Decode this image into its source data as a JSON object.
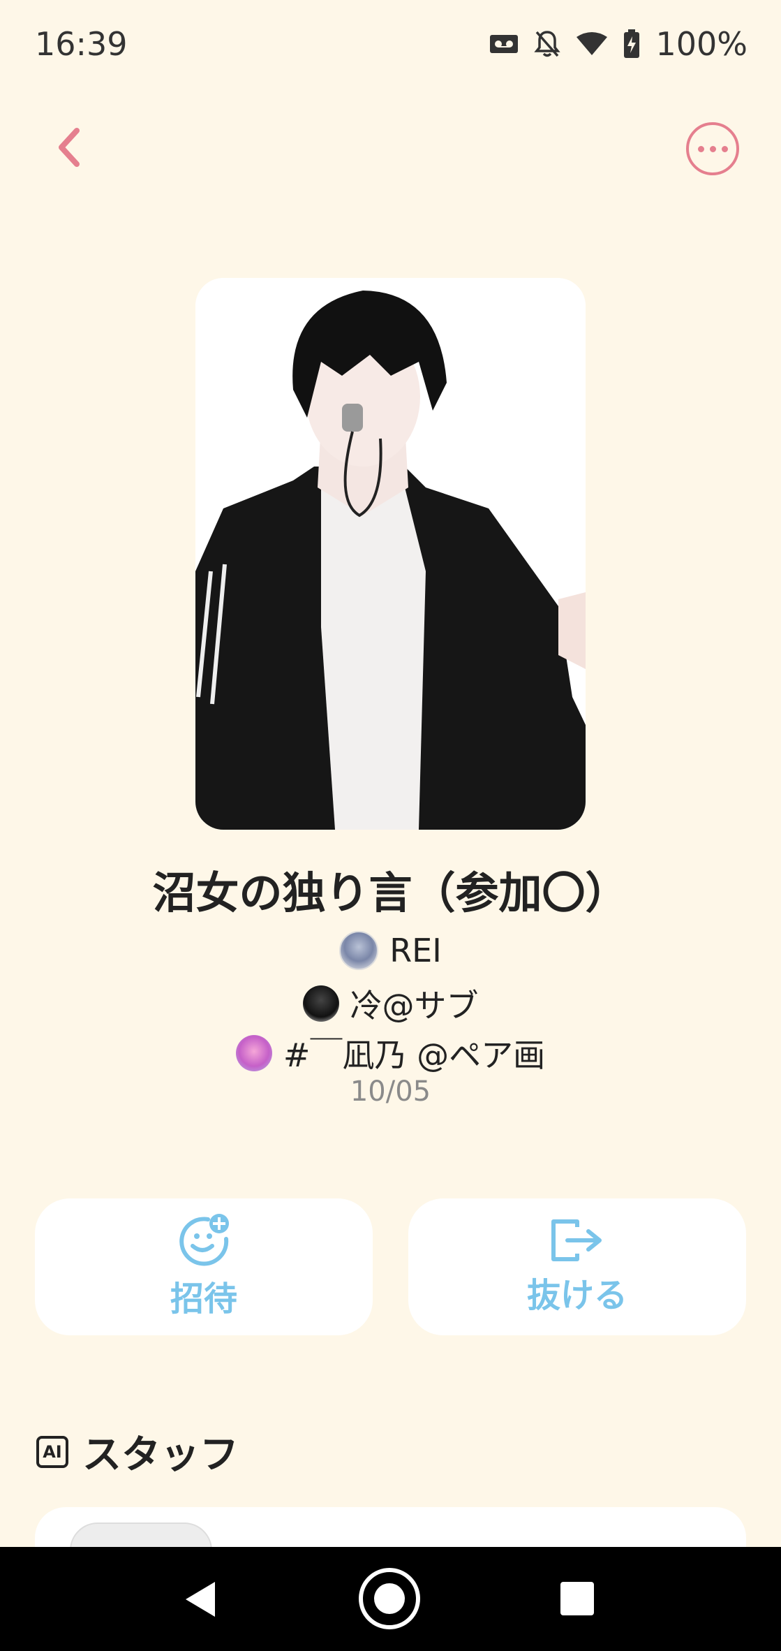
{
  "status_bar": {
    "time": "16:39",
    "battery": "100%"
  },
  "top_bar": {
    "back_icon": "chevron-left-icon",
    "more_icon": "more-horizontal-icon"
  },
  "room": {
    "title": "沼女の独り言（参加〇）",
    "members": [
      {
        "name": "REI"
      },
      {
        "name": "冷@サブ"
      },
      {
        "name": "#￣凪乃 @ペア画"
      }
    ],
    "date": "10/05"
  },
  "actions": {
    "invite_label": "招待",
    "leave_label": "抜ける"
  },
  "staff_section": {
    "badge": "AI",
    "title": "スタッフ"
  },
  "colors": {
    "accent_pink": "#E57F8E",
    "accent_blue": "#7AC4EA",
    "background": "#FEF7E8"
  }
}
